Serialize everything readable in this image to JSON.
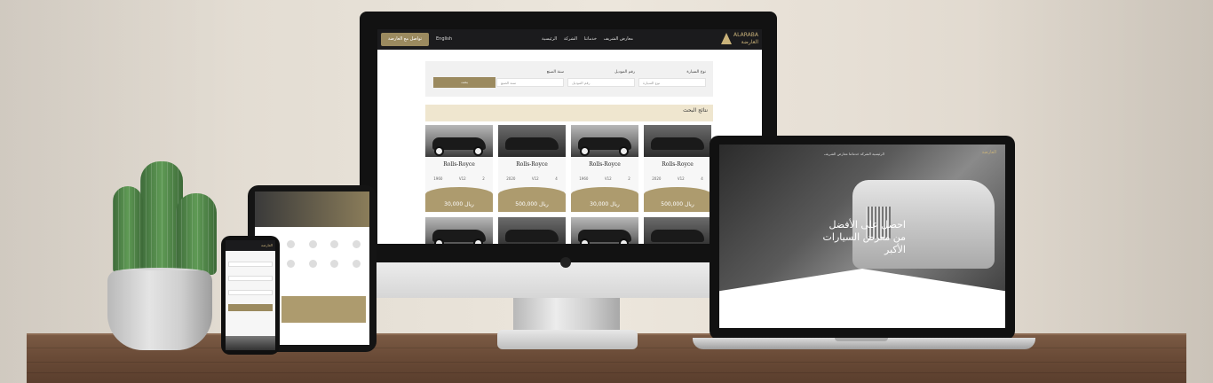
{
  "desktop": {
    "cta_label": "تواصل مع العارضة",
    "lang_label": "English",
    "menu": [
      "الرئيسية",
      "الشركة",
      "خدماتنا",
      "معارض الشريف"
    ],
    "brand_latin": "ALARABA",
    "brand_arabic": "العارضة",
    "search": {
      "fields": [
        {
          "label": "نوع السيارة",
          "placeholder": "نوع السيارة"
        },
        {
          "label": "رقم الموديل",
          "placeholder": "رقم الموديل"
        },
        {
          "label": "سنة الصنع",
          "placeholder": "سنة الصنع"
        }
      ],
      "button": "بحث"
    },
    "results_title": "نتائج البحث",
    "results_sub": "",
    "cards": [
      {
        "name": "Rolls-Royce",
        "price": "ريال 30,000",
        "specs": [
          "1960",
          "V12",
          "2"
        ]
      },
      {
        "name": "Rolls-Royce",
        "price": "ريال 500,000",
        "specs": [
          "2020",
          "V12",
          "4"
        ]
      },
      {
        "name": "Rolls-Royce",
        "price": "ريال 30,000",
        "specs": [
          "1960",
          "V12",
          "2"
        ]
      },
      {
        "name": "Rolls-Royce",
        "price": "ريال 500,000",
        "specs": [
          "2020",
          "V12",
          "4"
        ]
      }
    ]
  },
  "laptop": {
    "brand": "العارضة",
    "menu": "الرئيسية  الشركة  خدماتنا  معارض الشريف",
    "hero_line1": "احصل على الأفضل",
    "hero_line2": "من معرض السيارات الأكبر"
  },
  "phone": {
    "brand": "العارضة"
  },
  "colors": {
    "gold": "#9b8a5f",
    "dark": "#1b1b1d",
    "cream": "#efe6cf"
  }
}
